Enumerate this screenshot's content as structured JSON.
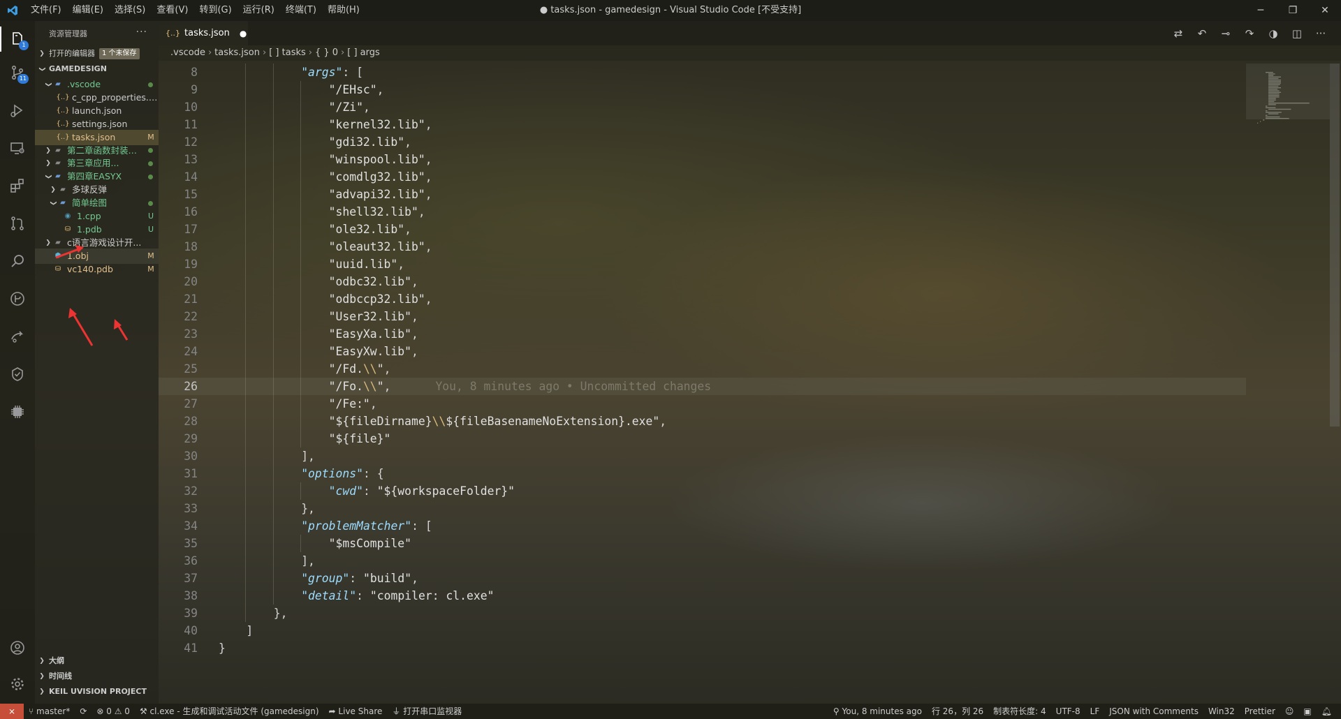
{
  "window": {
    "title": "● tasks.json - gamedesign - Visual Studio Code [不受支持]",
    "menu": [
      "文件(F)",
      "编辑(E)",
      "选择(S)",
      "查看(V)",
      "转到(G)",
      "运行(R)",
      "终端(T)",
      "帮助(H)"
    ]
  },
  "activity": {
    "explorer_badge": "1",
    "scm_badge": "11"
  },
  "sidebar": {
    "header": "资源管理器",
    "open_editors_label": "打开的编辑器",
    "open_editors_badge": "1 个未保存",
    "workspace": "GAMEDESIGN",
    "tree": [
      {
        "name": ".vscode",
        "status": "",
        "depth": 1,
        "kind": "folder-open",
        "color": "c-green"
      },
      {
        "name": "c_cpp_properties.json",
        "status": "",
        "depth": 2,
        "kind": "json",
        "color": ""
      },
      {
        "name": "launch.json",
        "status": "",
        "depth": 2,
        "kind": "json",
        "color": ""
      },
      {
        "name": "settings.json",
        "status": "",
        "depth": 2,
        "kind": "json",
        "color": ""
      },
      {
        "name": "tasks.json",
        "status": "M",
        "depth": 2,
        "kind": "json",
        "color": "c-orange"
      },
      {
        "name": "第二章函数封装的...",
        "status": "",
        "depth": 1,
        "kind": "folder",
        "color": "c-green"
      },
      {
        "name": "第三章应用...",
        "status": "",
        "depth": 1,
        "kind": "folder",
        "color": "c-green"
      },
      {
        "name": "第四章EASYX",
        "status": "",
        "depth": 1,
        "kind": "folder-open",
        "color": "c-green"
      },
      {
        "name": "多球反弹",
        "status": "",
        "depth": 2,
        "kind": "folder",
        "color": ""
      },
      {
        "name": "简单绘图",
        "status": "",
        "depth": 2,
        "kind": "folder-open",
        "color": "c-green"
      },
      {
        "name": "1.cpp",
        "status": "U",
        "depth": 3,
        "kind": "cpp",
        "color": "c-green"
      },
      {
        "name": "1.pdb",
        "status": "U",
        "depth": 3,
        "kind": "pdb",
        "color": "c-green"
      },
      {
        "name": "c语言游戏设计开...",
        "status": "",
        "depth": 1,
        "kind": "folder",
        "color": ""
      },
      {
        "name": "1.obj",
        "status": "M",
        "depth": 1,
        "kind": "obj",
        "color": "c-orange"
      },
      {
        "name": "vc140.pdb",
        "status": "M",
        "depth": 1,
        "kind": "pdb",
        "color": "c-orange"
      }
    ],
    "bottom_panels": [
      "大纲",
      "时间线",
      "KEIL UVISION PROJECT"
    ]
  },
  "tab": {
    "label": "tasks.json",
    "dirty": "●"
  },
  "breadcrumbs": [
    ".vscode",
    "tasks.json",
    "[ ] tasks",
    "{ } 0",
    "[ ] args"
  ],
  "editor": {
    "first_line": 8,
    "current_line": 26,
    "blame": "You, 8 minutes ago • Uncommitted changes",
    "lines": [
      {
        "indent": 3,
        "segs": [
          [
            "k",
            "\"args\""
          ],
          [
            "p",
            ": ["
          ]
        ]
      },
      {
        "indent": 4,
        "segs": [
          [
            "s",
            "\"/EHsc\""
          ],
          [
            "p",
            ","
          ]
        ]
      },
      {
        "indent": 4,
        "segs": [
          [
            "s",
            "\"/Zi\""
          ],
          [
            "p",
            ","
          ]
        ]
      },
      {
        "indent": 4,
        "segs": [
          [
            "s",
            "\"kernel32.lib\""
          ],
          [
            "p",
            ","
          ]
        ]
      },
      {
        "indent": 4,
        "segs": [
          [
            "s",
            "\"gdi32.lib\""
          ],
          [
            "p",
            ","
          ]
        ]
      },
      {
        "indent": 4,
        "segs": [
          [
            "s",
            "\"winspool.lib\""
          ],
          [
            "p",
            ","
          ]
        ]
      },
      {
        "indent": 4,
        "segs": [
          [
            "s",
            "\"comdlg32.lib\""
          ],
          [
            "p",
            ","
          ]
        ]
      },
      {
        "indent": 4,
        "segs": [
          [
            "s",
            "\"advapi32.lib\""
          ],
          [
            "p",
            ","
          ]
        ]
      },
      {
        "indent": 4,
        "segs": [
          [
            "s",
            "\"shell32.lib\""
          ],
          [
            "p",
            ","
          ]
        ]
      },
      {
        "indent": 4,
        "segs": [
          [
            "s",
            "\"ole32.lib\""
          ],
          [
            "p",
            ","
          ]
        ]
      },
      {
        "indent": 4,
        "segs": [
          [
            "s",
            "\"oleaut32.lib\""
          ],
          [
            "p",
            ","
          ]
        ]
      },
      {
        "indent": 4,
        "segs": [
          [
            "s",
            "\"uuid.lib\""
          ],
          [
            "p",
            ","
          ]
        ]
      },
      {
        "indent": 4,
        "segs": [
          [
            "s",
            "\"odbc32.lib\""
          ],
          [
            "p",
            ","
          ]
        ]
      },
      {
        "indent": 4,
        "segs": [
          [
            "s",
            "\"odbccp32.lib\""
          ],
          [
            "p",
            ","
          ]
        ]
      },
      {
        "indent": 4,
        "segs": [
          [
            "s",
            "\"User32.lib\""
          ],
          [
            "p",
            ","
          ]
        ]
      },
      {
        "indent": 4,
        "segs": [
          [
            "s",
            "\"EasyXa.lib\""
          ],
          [
            "p",
            ","
          ]
        ]
      },
      {
        "indent": 4,
        "segs": [
          [
            "s",
            "\"EasyXw.lib\""
          ],
          [
            "p",
            ","
          ]
        ]
      },
      {
        "indent": 4,
        "segs": [
          [
            "s",
            "\"/Fd."
          ],
          [
            "esc",
            "\\\\"
          ],
          [
            "s",
            "\""
          ],
          [
            "p",
            ","
          ]
        ]
      },
      {
        "indent": 4,
        "segs": [
          [
            "s",
            "\"/Fo."
          ],
          [
            "esc",
            "\\\\"
          ],
          [
            "s",
            "\""
          ],
          [
            "p",
            ","
          ]
        ]
      },
      {
        "indent": 4,
        "segs": [
          [
            "s",
            "\"/Fe:\""
          ],
          [
            "p",
            ","
          ]
        ]
      },
      {
        "indent": 4,
        "segs": [
          [
            "s",
            "\"${fileDirname}"
          ],
          [
            "esc",
            "\\\\"
          ],
          [
            "s",
            "${fileBasenameNoExtension}.exe\""
          ],
          [
            "p",
            ","
          ]
        ]
      },
      {
        "indent": 4,
        "segs": [
          [
            "s",
            "\"${file}\""
          ]
        ]
      },
      {
        "indent": 3,
        "segs": [
          [
            "p",
            "],"
          ]
        ]
      },
      {
        "indent": 3,
        "segs": [
          [
            "k",
            "\"options\""
          ],
          [
            "p",
            ": {"
          ]
        ]
      },
      {
        "indent": 4,
        "segs": [
          [
            "k",
            "\"cwd\""
          ],
          [
            "p",
            ": "
          ],
          [
            "s",
            "\"${workspaceFolder}\""
          ]
        ]
      },
      {
        "indent": 3,
        "segs": [
          [
            "p",
            "},"
          ]
        ]
      },
      {
        "indent": 3,
        "segs": [
          [
            "k",
            "\"problemMatcher\""
          ],
          [
            "p",
            ": ["
          ]
        ]
      },
      {
        "indent": 4,
        "segs": [
          [
            "s",
            "\"$msCompile\""
          ]
        ]
      },
      {
        "indent": 3,
        "segs": [
          [
            "p",
            "],"
          ]
        ]
      },
      {
        "indent": 3,
        "segs": [
          [
            "k",
            "\"group\""
          ],
          [
            "p",
            ": "
          ],
          [
            "s",
            "\"build\""
          ],
          [
            "p",
            ","
          ]
        ]
      },
      {
        "indent": 3,
        "segs": [
          [
            "k",
            "\"detail\""
          ],
          [
            "p",
            ": "
          ],
          [
            "s",
            "\"compiler: cl.exe\""
          ]
        ]
      },
      {
        "indent": 2,
        "segs": [
          [
            "p",
            "},"
          ]
        ]
      },
      {
        "indent": 1,
        "segs": [
          [
            "p",
            "]"
          ]
        ]
      },
      {
        "indent": 0,
        "segs": [
          [
            "p",
            "}"
          ]
        ]
      }
    ]
  },
  "statusbar": {
    "remote": "⨯",
    "branch": "master*",
    "sync": "⟳",
    "problems": "⊗ 0 ⚠ 0",
    "task": "cl.exe - 生成和调试活动文件 (gamedesign)",
    "liveshare": "Live Share",
    "serial": "打开串口监视器",
    "blame": "You, 8 minutes ago",
    "position": "行 26，列 26",
    "tabsize": "制表符长度: 4",
    "encoding": "UTF-8",
    "eol": "LF",
    "language": "JSON with Comments",
    "platform": "Win32",
    "formatter": "Prettier"
  },
  "colors": {
    "accent": "#2f7ad8",
    "remote": "#c74e39",
    "modified": "#e2c08d",
    "untracked": "#73c991",
    "key": "#9cdcfe"
  }
}
